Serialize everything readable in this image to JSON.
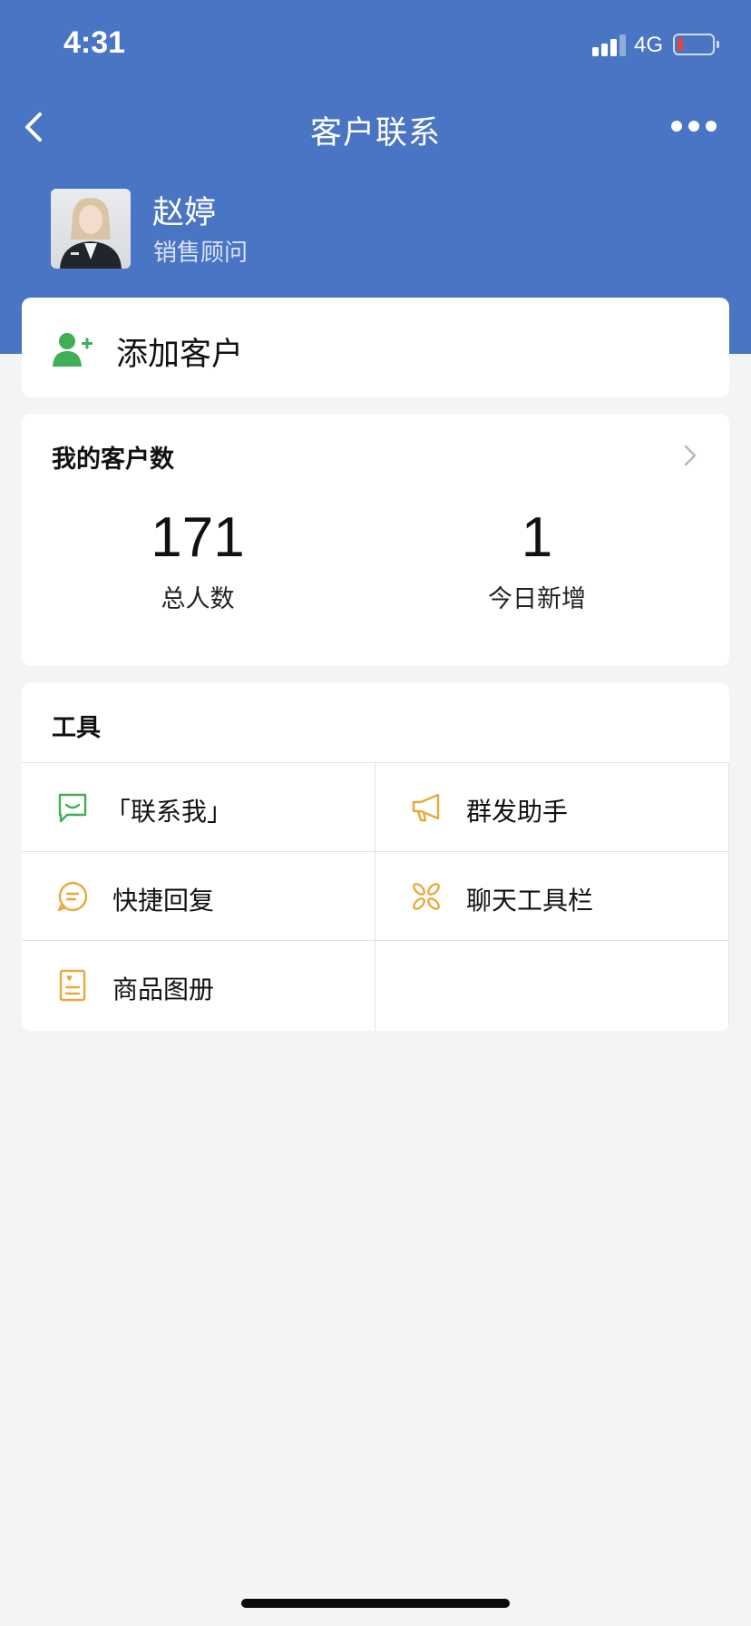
{
  "status_bar": {
    "time": "4:31",
    "network": "4G",
    "battery_level": 0.15,
    "battery_color": "#e5453b",
    "signal_bars_active": 3
  },
  "nav": {
    "title": "客户联系",
    "back_icon": "chevron-left-icon",
    "more_icon": "more-dots-icon"
  },
  "profile": {
    "name": "赵婷",
    "role": "销售顾问"
  },
  "add_customer": {
    "label": "添加客户",
    "icon": "add-user-icon",
    "icon_color": "#3fae55"
  },
  "stats": {
    "title": "我的客户数",
    "total_value": "171",
    "total_label": "总人数",
    "new_value": "1",
    "new_label": "今日新增"
  },
  "tools": {
    "title": "工具",
    "items": [
      {
        "label": "「联系我」",
        "icon": "contact-me-icon",
        "color": "#3fae55"
      },
      {
        "label": "群发助手",
        "icon": "megaphone-icon",
        "color": "#e8a93a"
      },
      {
        "label": "快捷回复",
        "icon": "quick-reply-icon",
        "color": "#e8a93a"
      },
      {
        "label": "聊天工具栏",
        "icon": "chat-toolbar-icon",
        "color": "#e8a93a"
      },
      {
        "label": "商品图册",
        "icon": "product-catalog-icon",
        "color": "#e8a93a"
      }
    ]
  },
  "colors": {
    "header_blue": "#4a74c4",
    "page_bg": "#f4f4f4"
  }
}
